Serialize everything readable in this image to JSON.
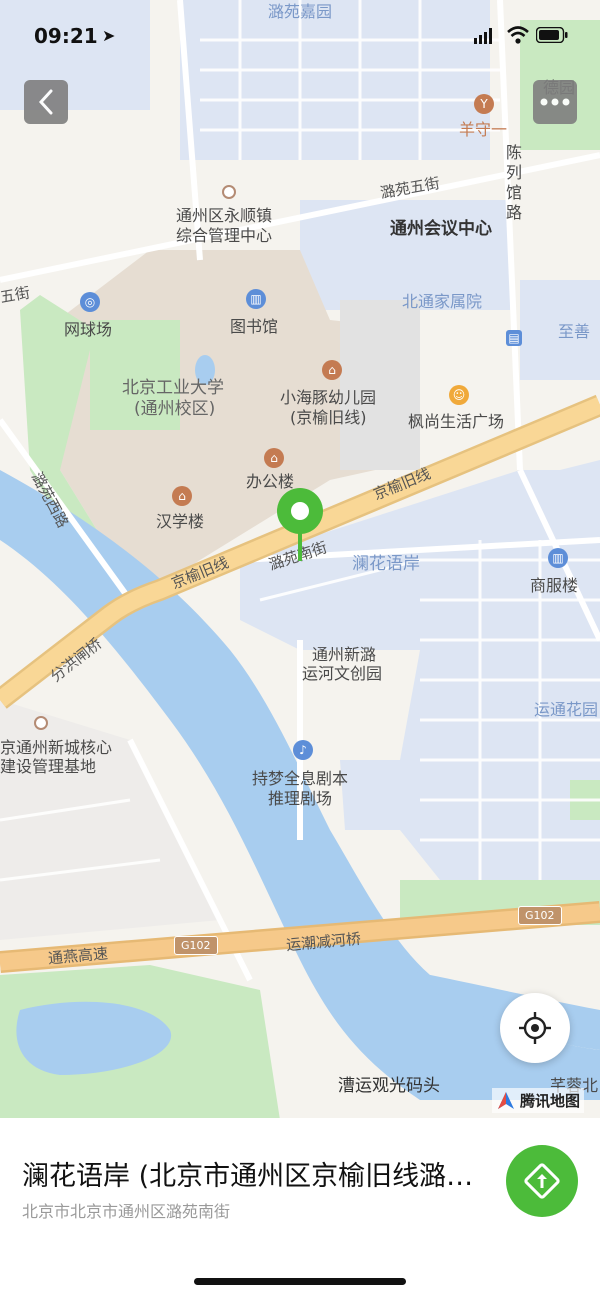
{
  "status_bar": {
    "time": "09:21"
  },
  "map": {
    "labels": {
      "luyuan_jiayuan": "潞苑嘉园",
      "yangshouyi": "羊守一",
      "deyuan": "德园",
      "chenlieguan_road": "陈列馆路",
      "luyuan_5th_st": "潞苑五街",
      "yongshun_town_1": "通州区永顺镇",
      "yongshun_town_2": "综合管理中心",
      "conference_center": "通州会议中心",
      "wu_jie": "五街",
      "beitong_jiashuyuan": "北通家属院",
      "zhishan": "至善",
      "tennis_court": "网球场",
      "library": "图书馆",
      "bjut_1": "北京工业大学",
      "bjut_2": "(通州校区)",
      "kindergarten_1": "小海豚幼儿园",
      "kindergarten_2": "(京榆旧线)",
      "fengshang_plaza": "枫尚生活广场",
      "office_building": "办公楼",
      "jingyu_old_line_ne": "京榆旧线",
      "luyuan_west_road": "潞苑西路",
      "hanxue_building": "汉学楼",
      "luyuan_south_st": "潞苑南街",
      "lanhua_yuan": "澜花语岸",
      "shangfu_building": "商服楼",
      "jingyu_old_line_sw": "京榆旧线",
      "fenhong_bridge": "分洪闸桥",
      "tongzhou_xinluo_1": "通州新潞",
      "tongzhou_xinluo_2": "运河文创园",
      "yuntong_huayuan": "运通花园",
      "core_area_1": "京通州新城核心",
      "core_area_2": "建设管理基地",
      "script_theater_1": "持梦全息剧本",
      "script_theater_2": "推理剧场",
      "g102_east": "G102",
      "g102_west": "G102",
      "tongyan_expressway": "通燕高速",
      "yunchao_bridge": "运潮减河桥",
      "caoyun_pier": "漕运观光码头",
      "yangrui_bei": "芊蓉北"
    },
    "brand": "腾讯地图"
  },
  "place": {
    "title": "澜花语岸 (北京市通州区京榆旧线潞苑南街)",
    "subtitle": "北京市北京市通州区潞苑南街"
  },
  "colors": {
    "map_bg": "#f5f3ee",
    "residential": "#dde5f3",
    "campus": "#e6ddd2",
    "green": "#c9e9c1",
    "water": "#a8cdef",
    "main_road": "#f9d796",
    "nav_green": "#4cbb3a"
  }
}
